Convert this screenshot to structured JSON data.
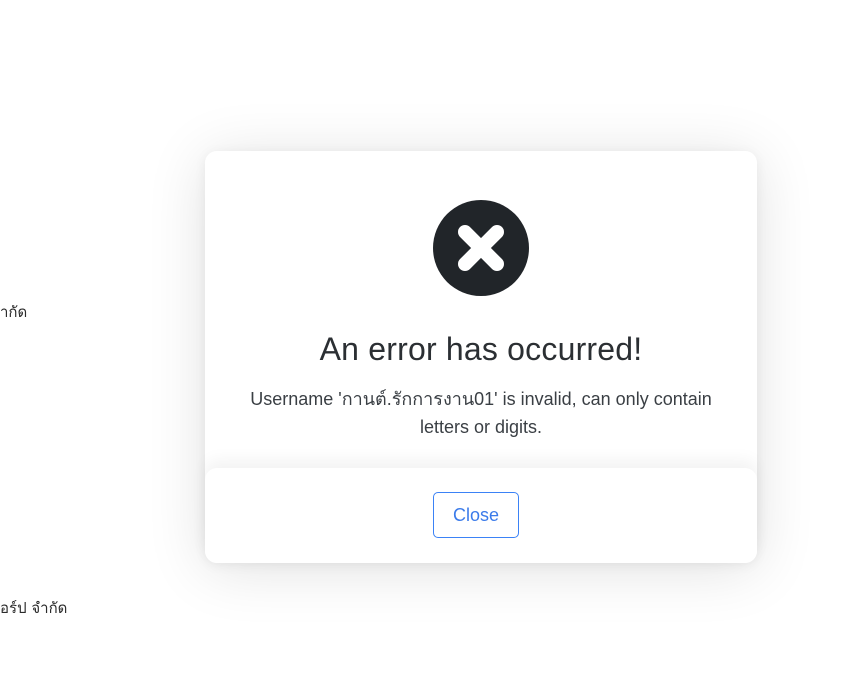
{
  "background": {
    "text_1": "ากัด",
    "text_2": "อร์ป จำกัด"
  },
  "dialog": {
    "icon": "error-x-circle-icon",
    "title": "An error has occurred!",
    "message": "Username 'กานต์.รักการงาน01' is invalid, can only contain letters or digits.",
    "close_label": "Close"
  },
  "colors": {
    "icon_bg": "#212529",
    "button_border": "#3b82f6",
    "button_text": "#3b7bea"
  }
}
